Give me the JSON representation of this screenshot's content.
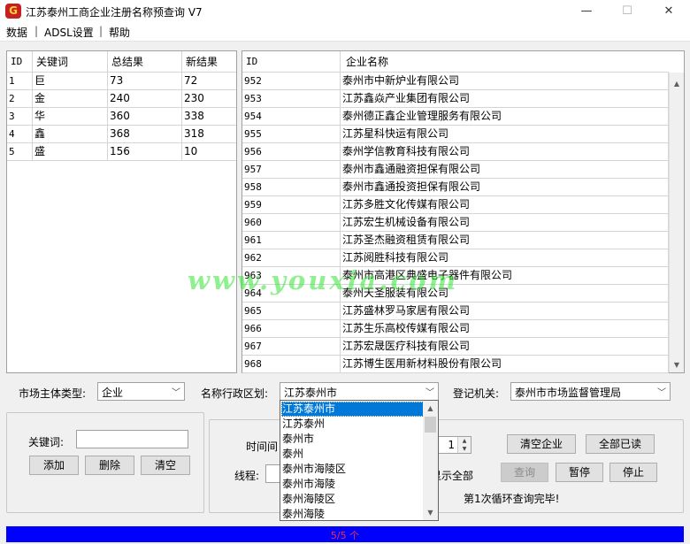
{
  "window": {
    "title": "江苏泰州工商企业注册名称预查询 V7",
    "minimize": "—",
    "maximize": "☐",
    "close": "✕",
    "icon": "app-logo-icon"
  },
  "menu": {
    "items": [
      "数据",
      "ADSL设置",
      "帮助"
    ],
    "separator": "|"
  },
  "keyword_table": {
    "columns": [
      "ID",
      "关键词",
      "总结果",
      "新结果"
    ],
    "rows": [
      {
        "id": "1",
        "keyword": "巨",
        "total": "73",
        "new": "72"
      },
      {
        "id": "2",
        "keyword": "金",
        "total": "240",
        "new": "230"
      },
      {
        "id": "3",
        "keyword": "华",
        "total": "360",
        "new": "338"
      },
      {
        "id": "4",
        "keyword": "鑫",
        "total": "368",
        "new": "318"
      },
      {
        "id": "5",
        "keyword": "盛",
        "total": "156",
        "new": "10"
      }
    ]
  },
  "company_table": {
    "columns": [
      "ID",
      "企业名称"
    ],
    "rows": [
      {
        "id": "952",
        "name": "泰州市中新炉业有限公司"
      },
      {
        "id": "953",
        "name": "江苏鑫焱产业集团有限公司"
      },
      {
        "id": "954",
        "name": "泰州德正鑫企业管理服务有限公司"
      },
      {
        "id": "955",
        "name": "江苏星科快运有限公司"
      },
      {
        "id": "956",
        "name": "泰州学信教育科技有限公司"
      },
      {
        "id": "957",
        "name": "泰州市鑫通融资担保有限公司"
      },
      {
        "id": "958",
        "name": "泰州市鑫通投资担保有限公司"
      },
      {
        "id": "959",
        "name": "江苏多胜文化传媒有限公司"
      },
      {
        "id": "960",
        "name": "江苏宏生机械设备有限公司"
      },
      {
        "id": "961",
        "name": "江苏圣杰融资租赁有限公司"
      },
      {
        "id": "962",
        "name": "江苏阅胜科技有限公司"
      },
      {
        "id": "963",
        "name": "泰州市高港区典盛电子器件有限公司"
      },
      {
        "id": "964",
        "name": "泰州天圣服装有限公司"
      },
      {
        "id": "965",
        "name": "江苏盛林罗马家居有限公司"
      },
      {
        "id": "966",
        "name": "江苏生乐高校传媒有限公司"
      },
      {
        "id": "967",
        "name": "江苏宏晟医疗科技有限公司"
      },
      {
        "id": "968",
        "name": "江苏博生医用新材料股份有限公司"
      }
    ]
  },
  "filters": {
    "market_type_label": "市场主体类型:",
    "market_type_value": "企业",
    "region_label": "名称行政区划:",
    "region_value": "江苏泰州市",
    "authority_label": "登记机关:",
    "authority_value": "泰州市市场监督管理局"
  },
  "region_options": [
    "江苏泰州市",
    "江苏泰州",
    "泰州市",
    "泰州",
    "泰州市海陵区",
    "泰州市海陵",
    "泰州海陵区",
    "泰州海陵"
  ],
  "keyword_panel": {
    "label": "关键词:",
    "value": "",
    "add": "添加",
    "delete": "删除",
    "clear": "清空"
  },
  "control_panel": {
    "interval_label": "时间间",
    "interval_value": "1",
    "thread_label": "线程:",
    "show_all_label": "显示全部",
    "clear_companies": "清空企业",
    "all_read": "全部已读",
    "query": "查询",
    "pause": "暂停",
    "stop": "停止",
    "status": "第1次循环查询完毕!"
  },
  "progress": {
    "text": "5/5 个",
    "fraction": 1.0,
    "color": "#0000ff"
  },
  "watermark": "www.youxia.com"
}
